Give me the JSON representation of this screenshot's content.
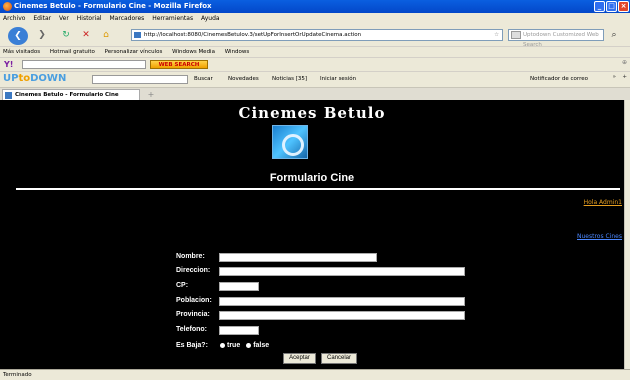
{
  "window": {
    "title": "Cinemes Betulo - Formulario Cine - Mozilla Firefox"
  },
  "menu": [
    "Archivo",
    "Editar",
    "Ver",
    "Historial",
    "Marcadores",
    "Herramientas",
    "Ayuda"
  ],
  "nav": {
    "url": "http://localhost:8080/CinemesBetulov.3/setUpForInsertOrUpdateCinema.action",
    "search_placeholder": "Uptodown Customized Web Search"
  },
  "bookmarks": [
    "Más visitados",
    "Hotmail gratuito",
    "Personalizar vínculos",
    "Windows Media",
    "Windows"
  ],
  "toolbar1": {
    "web_search_label": "WEB SEARCH"
  },
  "toolbar2": {
    "buscar": "Buscar",
    "novedades": "Novedades",
    "noticias": "Noticias [35]",
    "iniciar_sesion": "Iniciar sesión",
    "notificador": "Notificador de correo"
  },
  "tab": {
    "label": "Cinemes Betulo - Formulario Cine"
  },
  "page": {
    "banner": "Cinemes Betulo",
    "heading": "Formulario Cine",
    "admin_link": "Hola Admin1",
    "cines_link": "Nuestros Cines",
    "fields": {
      "nombre": "Nombre:",
      "direccion": "Direccion:",
      "cp": "CP:",
      "poblacion": "Poblacion:",
      "provincia": "Provincia:",
      "telefono": "Telefono:",
      "es_baja": "Es Baja?:"
    },
    "radio_true": "true",
    "radio_false": "false",
    "accept_label": "Aceptar",
    "cancel_label": "Cancelar"
  },
  "status": "Terminado"
}
